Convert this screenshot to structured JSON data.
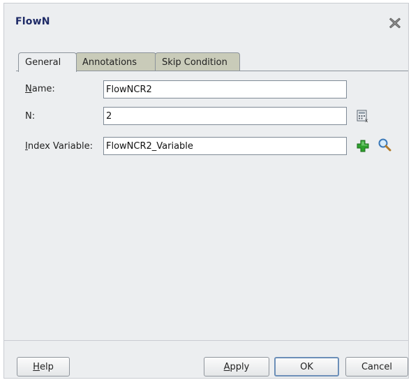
{
  "dialog": {
    "title": "FlowN",
    "close_icon": "close-x-icon"
  },
  "tabs": [
    {
      "label": "General",
      "active": true
    },
    {
      "label": "Annotations",
      "active": false
    },
    {
      "label": "Skip Condition",
      "active": false
    }
  ],
  "form": {
    "name": {
      "label_mnemonic": "N",
      "label_rest": "ame:",
      "value": "FlowNCR2"
    },
    "n": {
      "label": "N:",
      "value": "2",
      "icon": "expression-builder-icon"
    },
    "index_variable": {
      "label_mnemonic": "I",
      "label_rest": "ndex Variable:",
      "value": "FlowNCR2_Variable",
      "add_icon": "add-plus-icon",
      "search_icon": "search-magnifier-icon"
    }
  },
  "buttons": {
    "help_mnemonic": "H",
    "help_rest": "elp",
    "apply_mnemonic": "A",
    "apply_rest": "pply",
    "ok": "OK",
    "cancel": "Cancel"
  },
  "colors": {
    "title": "#1e2a66",
    "tab_inactive": "#c9cbb9",
    "panel_bg": "#eceef0",
    "plus_green": "#2ea12e"
  }
}
